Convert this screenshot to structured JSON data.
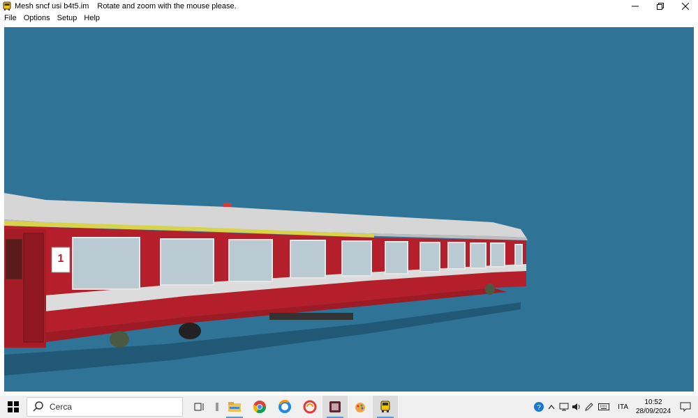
{
  "window": {
    "title": "Mesh sncf usi b4t5.im",
    "hint": "Rotate and zoom with the mouse please.",
    "controls": {
      "minimize": "—",
      "restore": "❐",
      "close": "✕"
    }
  },
  "menu": [
    {
      "label": "File"
    },
    {
      "label": "Options"
    },
    {
      "label": "Setup"
    },
    {
      "label": "Help"
    }
  ],
  "viewport": {
    "background": "#2f7396",
    "coach_color": "#b0202a",
    "roof_color": "#d4d4d4",
    "stripe_color": "#dedede",
    "first_class_label": "1"
  },
  "taskbar": {
    "search_placeholder": "Cerca",
    "apps": [
      "task-view-icon",
      "file-explorer-icon",
      "chrome-icon",
      "browser-icon",
      "ccleaner-icon",
      "video-app-icon",
      "paint-app-icon",
      "train-app-icon"
    ],
    "tray": {
      "language": "ITA",
      "time": "10:52",
      "date": "28/09/2024"
    }
  }
}
